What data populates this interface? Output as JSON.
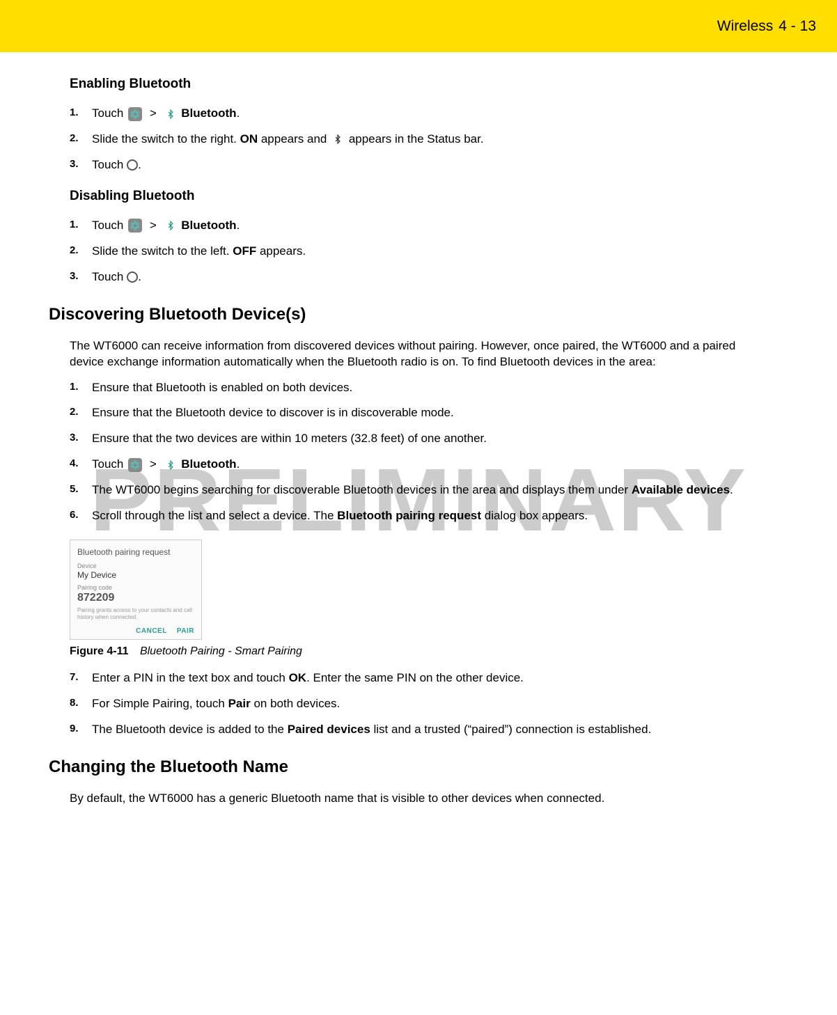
{
  "header": {
    "section": "Wireless",
    "page": "4 - 13"
  },
  "watermark": "PRELIMINARY",
  "sec1": {
    "title": "Enabling Bluetooth",
    "steps": {
      "s1a": "Touch ",
      "s1b": "Bluetooth",
      "s1c": ".",
      "s2a": "Slide the switch to the right. ",
      "s2b": "ON",
      "s2c": " appears and ",
      "s2d": " appears in the Status bar.",
      "s3a": "Touch ",
      "s3b": "."
    }
  },
  "sec2": {
    "title": "Disabling Bluetooth",
    "steps": {
      "s1a": "Touch ",
      "s1b": "Bluetooth",
      "s1c": ".",
      "s2a": "Slide the switch to the left. ",
      "s2b": "OFF",
      "s2c": " appears.",
      "s3a": "Touch ",
      "s3b": "."
    }
  },
  "sec3": {
    "title": "Discovering Bluetooth Device(s)",
    "intro": "The WT6000 can receive information from discovered devices without pairing. However, once paired, the WT6000 and a paired device exchange information automatically when the Bluetooth radio is on. To find Bluetooth devices in the area:",
    "steps": {
      "s1": "Ensure that Bluetooth is enabled on both devices.",
      "s2": "Ensure that the Bluetooth device to discover is in discoverable mode.",
      "s3": "Ensure that the two devices are within 10 meters (32.8 feet) of one another.",
      "s4a": "Touch ",
      "s4b": "Bluetooth",
      "s4c": ".",
      "s5a": "The WT6000 begins searching for discoverable Bluetooth devices in the area and displays them under ",
      "s5b": "Available devices",
      "s5c": ".",
      "s6a": "Scroll through the list and select a device. The ",
      "s6b": "Bluetooth pairing request",
      "s6c": " dialog box appears.",
      "s7a": "Enter a PIN in the text box and touch ",
      "s7b": "OK",
      "s7c": ". Enter the same PIN on the other device.",
      "s8a": "For Simple Pairing, touch ",
      "s8b": "Pair",
      "s8c": " on both devices.",
      "s9a": "The Bluetooth device is added to the ",
      "s9b": "Paired devices",
      "s9c": " list and a trusted (“paired”) connection is established."
    }
  },
  "dialog": {
    "title": "Bluetooth pairing request",
    "device_label": "Device",
    "device_name": "My Device",
    "code_label": "Pairing code",
    "code": "872209",
    "note": "Pairing grants access to your contacts and call history when connected.",
    "cancel": "CANCEL",
    "pair": "PAIR"
  },
  "figure": {
    "number": "Figure 4-11",
    "title": "Bluetooth Pairing - Smart Pairing"
  },
  "sec4": {
    "title": "Changing the Bluetooth Name",
    "intro": "By default, the WT6000 has a generic Bluetooth name that is visible to other devices when connected."
  },
  "sep_gt": ">"
}
